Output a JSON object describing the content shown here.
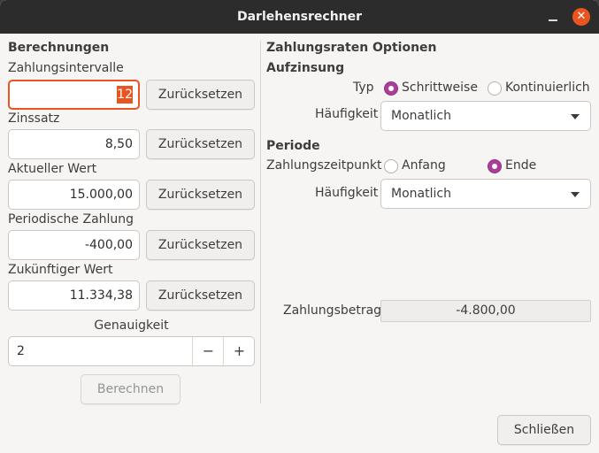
{
  "window": {
    "title": "Darlehensrechner"
  },
  "left": {
    "heading": "Berechnungen",
    "fields": [
      {
        "label": "Zahlungsintervalle",
        "value": "12"
      },
      {
        "label": "Zinssatz",
        "value": "8,50"
      },
      {
        "label": "Aktueller Wert",
        "value": "15.000,00"
      },
      {
        "label": "Periodische Zahlung",
        "value": "-400,00"
      },
      {
        "label": "Zukünftiger Wert",
        "value": "11.334,38"
      }
    ],
    "reset_label": "Zurücksetzen",
    "precision_label": "Genauigkeit",
    "precision_value": "2",
    "minus_symbol": "−",
    "plus_symbol": "+",
    "calculate_label": "Berechnen"
  },
  "right": {
    "heading": "Zahlungsraten Optionen",
    "compounding": {
      "heading": "Aufzinsung",
      "type_label": "Typ",
      "options": [
        "Schrittweise",
        "Kontinuierlich"
      ],
      "selected": "Schrittweise",
      "frequency_label": "Häufigkeit",
      "frequency_value": "Monatlich"
    },
    "period": {
      "heading": "Periode",
      "timing_label": "Zahlungszeitpunkt",
      "options": [
        "Anfang",
        "Ende"
      ],
      "selected": "Ende",
      "frequency_label": "Häufigkeit",
      "frequency_value": "Monatlich"
    },
    "payment_label": "Zahlungsbetrag",
    "payment_value": "-4.800,00"
  },
  "footer": {
    "close_label": "Schließen"
  },
  "colors": {
    "accent": "#e95420",
    "radio_checked": "#aa3f9b",
    "titlebar": "#2c2c2c",
    "window_bg": "#f6f5f4"
  }
}
